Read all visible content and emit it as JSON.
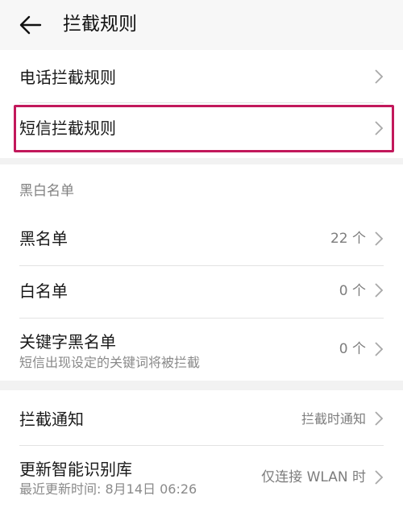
{
  "header": {
    "title": "拦截规则",
    "back_icon": "arrow-left-icon"
  },
  "rules": {
    "phone": {
      "label": "电话拦截规则"
    },
    "sms": {
      "label": "短信拦截规则"
    }
  },
  "lists": {
    "section_title": "黑白名单",
    "blacklist": {
      "label": "黑名单",
      "value": "22 个"
    },
    "whitelist": {
      "label": "白名单",
      "value": "0 个"
    },
    "keyword_blacklist": {
      "label": "关键字黑名单",
      "sublabel": "短信出现设定的关键词将被拦截",
      "value": "0 个"
    }
  },
  "notify": {
    "label": "拦截通知",
    "value": "拦截时通知"
  },
  "update": {
    "label": "更新智能识别库",
    "sublabel": "最近更新时间: 8月14日 06:26",
    "value": "仅连接 WLAN 时"
  },
  "colors": {
    "highlight": "#c2185b",
    "background": "#f2f2f2"
  }
}
